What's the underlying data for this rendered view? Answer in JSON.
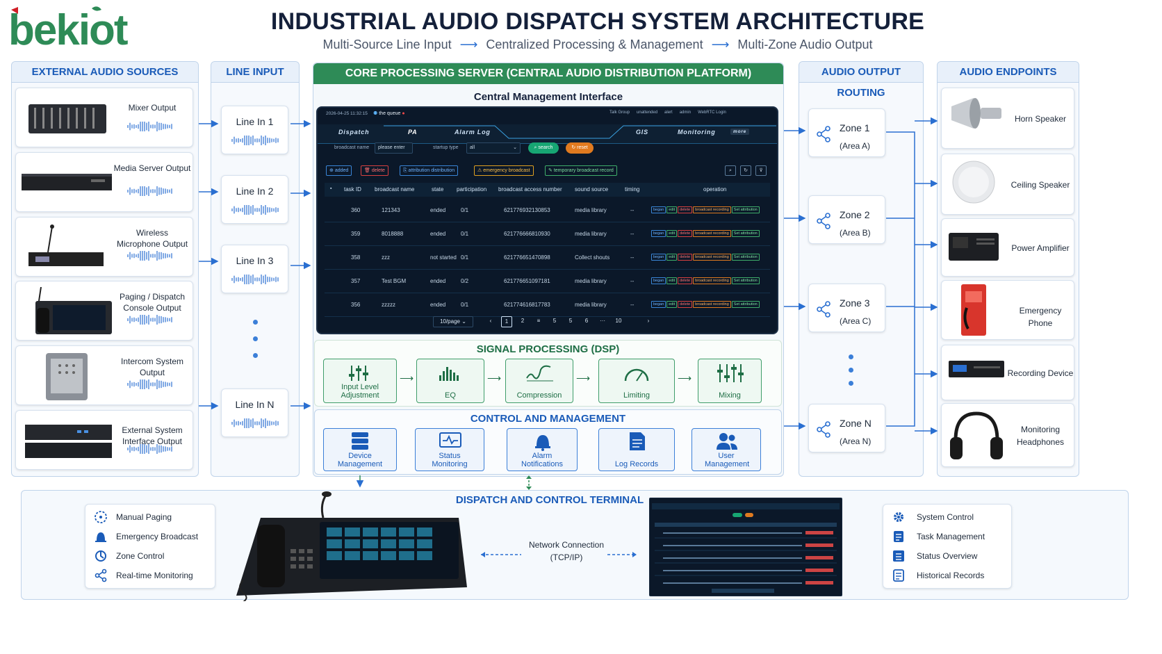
{
  "logo_text": "bekiot",
  "title": "INDUSTRIAL AUDIO DISPATCH SYSTEM ARCHITECTURE",
  "subtitle": [
    "Multi-Source Line Input",
    "Centralized Processing & Management",
    "Multi-Zone Audio Output"
  ],
  "sources": {
    "header": "EXTERNAL AUDIO SOURCES",
    "items": [
      "Mixer Output",
      "Media Server Output",
      "Wireless Microphone Output",
      "Paging / Dispatch Console Output",
      "Intercom System Output",
      "External System Interface Output"
    ]
  },
  "line_input": {
    "header": "LINE INPUT",
    "items": [
      "Line In 1",
      "Line In 2",
      "Line In 3",
      "Line In N"
    ]
  },
  "core": {
    "header": "CORE PROCESSING SERVER (CENTRAL AUDIO DISTRIBUTION PLATFORM)",
    "interface_title": "Central Management Interface",
    "screen": {
      "timestamp": "2026-04-25 11:32:15",
      "queue": "the queue",
      "top_right": [
        "Talk Group",
        "unattended",
        "alert",
        "admin",
        "WebRTC Login"
      ],
      "tabs": [
        "Dispatch",
        "PA",
        "Alarm Log",
        "GIS",
        "Monitoring",
        "more"
      ],
      "filter_label1": "broadcast name",
      "filter_ph1": "please enter",
      "filter_label2": "startup type",
      "filter_val2": "all",
      "btn_search": "search",
      "btn_reset": "reset",
      "actions": [
        "added",
        "delete",
        "attribution distribution",
        "emergency broadcast",
        "temporary broadcast record"
      ],
      "columns": [
        "task ID",
        "broadcast name",
        "state",
        "participation",
        "broadcast access number",
        "sound source",
        "timing",
        "operation"
      ],
      "rows": [
        [
          "360",
          "121343",
          "ended",
          "0/1",
          "621776932130853",
          "media library",
          "--"
        ],
        [
          "359",
          "8018888",
          "ended",
          "0/1",
          "621776666810930",
          "media library",
          "--"
        ],
        [
          "358",
          "zzz",
          "not started",
          "0/1",
          "621776651470898",
          "Collect shouts",
          "--"
        ],
        [
          "357",
          "Test BGM",
          "ended",
          "0/2",
          "621776651097181",
          "media library",
          "--"
        ],
        [
          "356",
          "zzzzz",
          "ended",
          "0/1",
          "621774616817783",
          "media library",
          "--"
        ]
      ],
      "row_ops": [
        "began",
        "edit",
        "delete",
        "broadcast recording",
        "Set attribution"
      ],
      "page_size": "10/page",
      "pages": [
        "1",
        "2",
        "≡",
        "5",
        "5",
        "6",
        "···",
        "10"
      ]
    }
  },
  "dsp": {
    "header": "SIGNAL PROCESSING (DSP)",
    "items": [
      "Input Level Adjustment",
      "EQ",
      "Compression",
      "Limiting",
      "Mixing"
    ]
  },
  "control": {
    "header": "CONTROL AND MANAGEMENT",
    "items": [
      "Device Management",
      "Status Monitoring",
      "Alarm Notifications",
      "Log Records",
      "User Management"
    ]
  },
  "routing": {
    "header": "AUDIO OUTPUT ROUTING",
    "zones": [
      [
        "Zone 1",
        "(Area A)"
      ],
      [
        "Zone 2",
        "(Area B)"
      ],
      [
        "Zone 3",
        "(Area C)"
      ],
      [
        "Zone N",
        "(Area N)"
      ]
    ]
  },
  "endpoints": {
    "header": "AUDIO ENDPOINTS",
    "items": [
      "Horn Speaker",
      "Ceiling Speaker",
      "Power Amplifier",
      "Emergency Phone",
      "Recording Device",
      "Monitoring Headphones"
    ]
  },
  "terminal": {
    "header": "DISPATCH AND CONTROL TERMINAL",
    "left_features": [
      "Manual Paging",
      "Emergency Broadcast",
      "Zone Control",
      "Real-time Monitoring"
    ],
    "network": [
      "Network Connection",
      "(TCP/IP)"
    ],
    "right_features": [
      "System Control",
      "Task Management",
      "Status Overview",
      "Historical Records"
    ]
  },
  "colors": {
    "brand_green": "#2e8b57",
    "brand_red": "#d11f26",
    "accent_blue": "#1a5bb8",
    "screen_bg": "#0b1829"
  }
}
